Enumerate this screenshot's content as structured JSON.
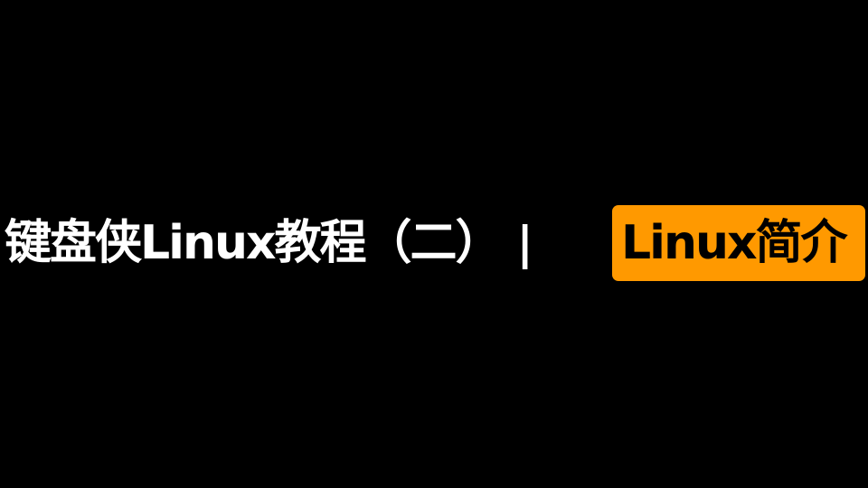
{
  "title": {
    "main": "键盘侠Linux教程（二）",
    "separator": "|",
    "badge": "Linux简介"
  },
  "colors": {
    "background": "#000000",
    "title_text": "#ffffff",
    "badge_background": "#ff9900",
    "badge_text": "#000000"
  }
}
